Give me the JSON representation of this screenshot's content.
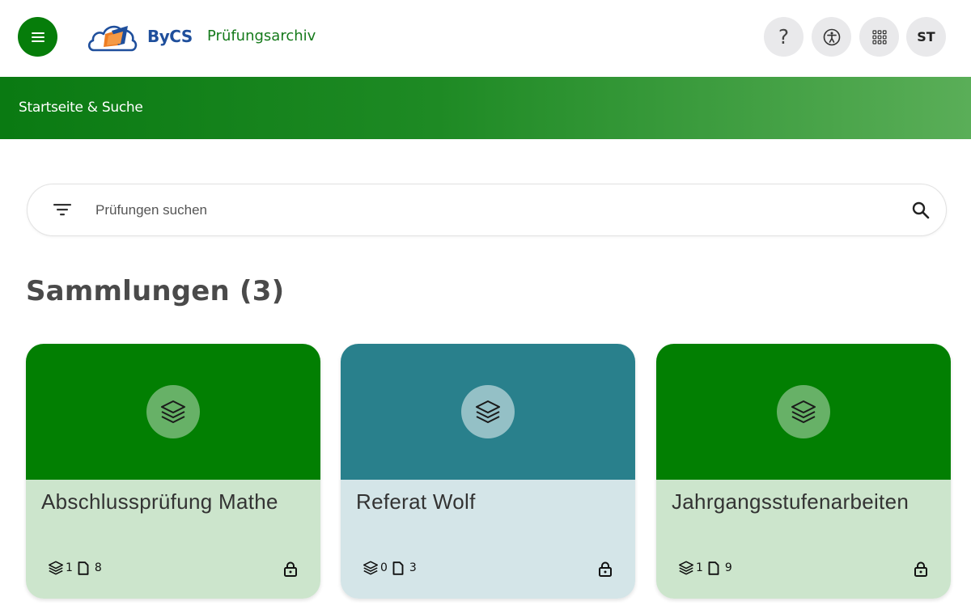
{
  "header": {
    "logo_text": "ByCS",
    "app_title": "Prüfungsarchiv",
    "help_label": "?",
    "avatar_initials": "ST"
  },
  "banner": {
    "breadcrumb": "Startseite & Suche"
  },
  "search": {
    "placeholder": "Prüfungen suchen"
  },
  "collections": {
    "title": "Sammlungen (3)",
    "cards": [
      {
        "title": "Abschlussprüfung Mathe",
        "layers": "1",
        "docs": "8",
        "head_color": "#027f02",
        "body_color": "#cce5cc",
        "circle_color": "#67b167"
      },
      {
        "title": "Referat Wolf",
        "layers": "0",
        "docs": "3",
        "head_color": "#29808c",
        "body_color": "#d4e5e8",
        "circle_color": "#94c0c6"
      },
      {
        "title": "Jahrgangsstufenarbeiten",
        "layers": "1",
        "docs": "9",
        "head_color": "#027f02",
        "body_color": "#cce5cc",
        "circle_color": "#67b167"
      }
    ]
  },
  "colors": {
    "brand_green": "#067d0a",
    "logo_blue": "#1f4f9c",
    "logo_orange": "#ee7d22"
  }
}
